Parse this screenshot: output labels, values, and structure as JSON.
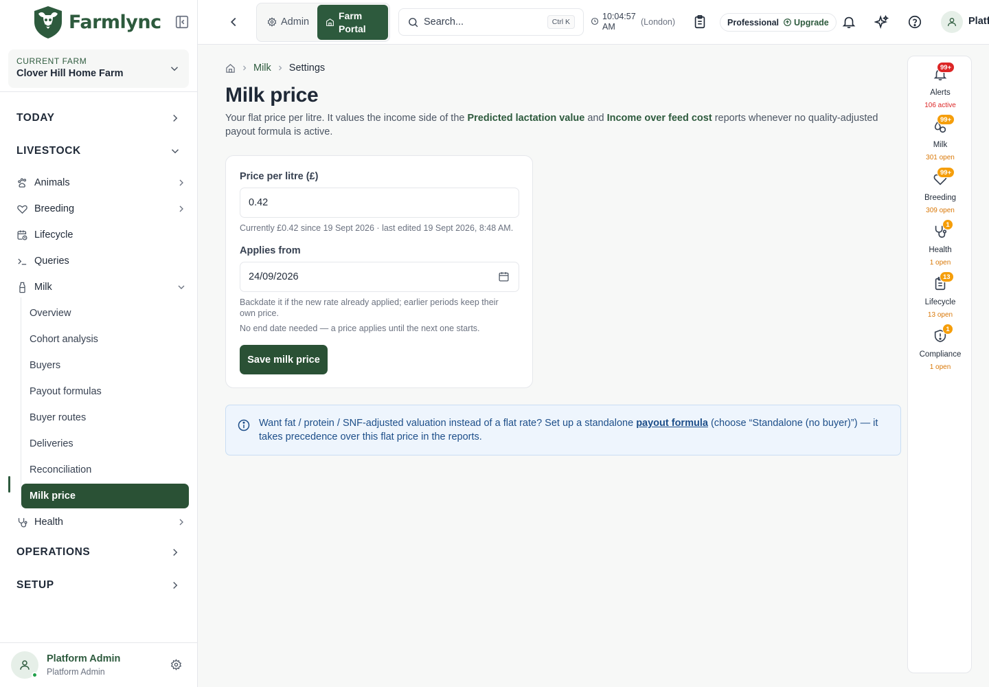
{
  "brand": {
    "name": "Farmlync"
  },
  "farm": {
    "label": "Current farm",
    "name": "Clover Hill Home Farm"
  },
  "nav": {
    "today": "TODAY",
    "livestock": "LIVESTOCK",
    "animals": "Animals",
    "breeding": "Breeding",
    "lifecycle": "Lifecycle",
    "queries": "Queries",
    "milk": "Milk",
    "milk_sub": [
      "Overview",
      "Cohort analysis",
      "Buyers",
      "Payout formulas",
      "Buyer routes",
      "Deliveries",
      "Reconciliation"
    ],
    "milk_active": "Milk price",
    "health": "Health",
    "operations": "OPERATIONS",
    "setup": "SETUP"
  },
  "user": {
    "name": "Platform Admin",
    "role": "Platform Admin"
  },
  "topbar": {
    "admin_tab": "Admin",
    "farm_tab": "Farm Portal",
    "search_placeholder": "Search...",
    "search_shortcut": "Ctrl K",
    "time": "10:04:57 AM",
    "timezone": "(London)",
    "plan": "Professional",
    "upgrade": "Upgrade",
    "user_short": "Platform Admin"
  },
  "breadcrumb": {
    "milk": "Milk",
    "current": "Settings"
  },
  "page": {
    "title": "Milk price",
    "desc_before": "Your flat price per litre. It values the income side of the ",
    "desc_link1": "Predicted lactation value",
    "desc_mid": " and ",
    "desc_link2": "Income over feed cost",
    "desc_after": " reports whenever no quality-adjusted payout formula is active."
  },
  "form": {
    "price_label": "Price per litre (£)",
    "price_value": "0.42",
    "price_help": "Currently £0.42 since 19 Sept 2026 · last edited 19 Sept 2026, 8:48 AM.",
    "date_label": "Applies from",
    "date_value": "24/09/2026",
    "date_help1": "Backdate it if the new rate already applied; earlier periods keep their own price.",
    "date_help2": "No end date needed — a price applies until the next one starts.",
    "save": "Save milk price"
  },
  "info": {
    "before": "Want fat / protein / SNF-adjusted valuation instead of a flat rate? Set up a standalone ",
    "link": "payout formula",
    "after": " (choose “Standalone (no buyer)”) — it takes precedence over this flat price in the reports."
  },
  "rail": [
    {
      "label": "Alerts",
      "badge": "99+",
      "count": "106 active",
      "badge_color": "#dc2626",
      "count_color": "#dc2626",
      "icon": "bell-icon"
    },
    {
      "label": "Milk",
      "badge": "99+",
      "count": "301 open",
      "badge_color": "#f59e0b",
      "count_color": "#d97706",
      "icon": "milk-drops-icon"
    },
    {
      "label": "Breeding",
      "badge": "99+",
      "count": "309 open",
      "badge_color": "#f59e0b",
      "count_color": "#d97706",
      "icon": "heart-icon"
    },
    {
      "label": "Health",
      "badge": "1",
      "count": "1 open",
      "badge_color": "#f59e0b",
      "count_color": "#d97706",
      "icon": "stethoscope-icon"
    },
    {
      "label": "Lifecycle",
      "badge": "13",
      "count": "13 open",
      "badge_color": "#f59e0b",
      "count_color": "#d97706",
      "icon": "clipboard-icon"
    },
    {
      "label": "Compliance",
      "badge": "1",
      "count": "1 open",
      "badge_color": "#f59e0b",
      "count_color": "#d97706",
      "icon": "shield-alert-icon"
    }
  ],
  "colors": {
    "brand": "#2d5a3d",
    "active": "#2a5135",
    "info_bg": "#eef5fd",
    "info_text": "#1d4e89"
  }
}
